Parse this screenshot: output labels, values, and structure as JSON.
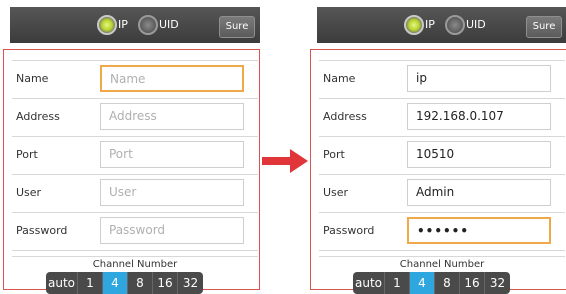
{
  "left": {
    "topbar": {
      "ip_label": "IP",
      "uid_label": "UID",
      "sure_label": "Sure",
      "selected": "IP"
    },
    "fields": [
      {
        "label": "Name",
        "value": "",
        "placeholder": "Name"
      },
      {
        "label": "Address",
        "value": "",
        "placeholder": "Address"
      },
      {
        "label": "Port",
        "value": "",
        "placeholder": "Port"
      },
      {
        "label": "User",
        "value": "",
        "placeholder": "User"
      },
      {
        "label": "Password",
        "value": "",
        "placeholder": "Password"
      }
    ],
    "channel": {
      "title": "Channel Number",
      "options": [
        "auto",
        "1",
        "4",
        "8",
        "16",
        "32"
      ],
      "selected": "4"
    }
  },
  "right": {
    "topbar": {
      "ip_label": "IP",
      "uid_label": "UID",
      "sure_label": "Sure",
      "selected": "IP"
    },
    "fields": [
      {
        "label": "Name",
        "value": "ip",
        "placeholder": ""
      },
      {
        "label": "Address",
        "value": "192.168.0.107",
        "placeholder": ""
      },
      {
        "label": "Port",
        "value": "10510",
        "placeholder": ""
      },
      {
        "label": "User",
        "value": "Admin",
        "placeholder": ""
      },
      {
        "label": "Password",
        "value": "••••••",
        "placeholder": ""
      }
    ],
    "channel": {
      "title": "Channel Number",
      "options": [
        "auto",
        "1",
        "4",
        "8",
        "16",
        "32"
      ],
      "selected": "4"
    }
  },
  "colors": {
    "accent_blue": "#2ea6e0",
    "focus_orange": "#f0a94a",
    "arrow_red": "#e0363a",
    "frame_red": "#d9534f",
    "radio_green": "#b7d42c"
  },
  "icons": {
    "arrow": "right-arrow-icon",
    "radio_selected": "radio-selected-icon",
    "radio_unselected": "radio-unselected-icon"
  }
}
